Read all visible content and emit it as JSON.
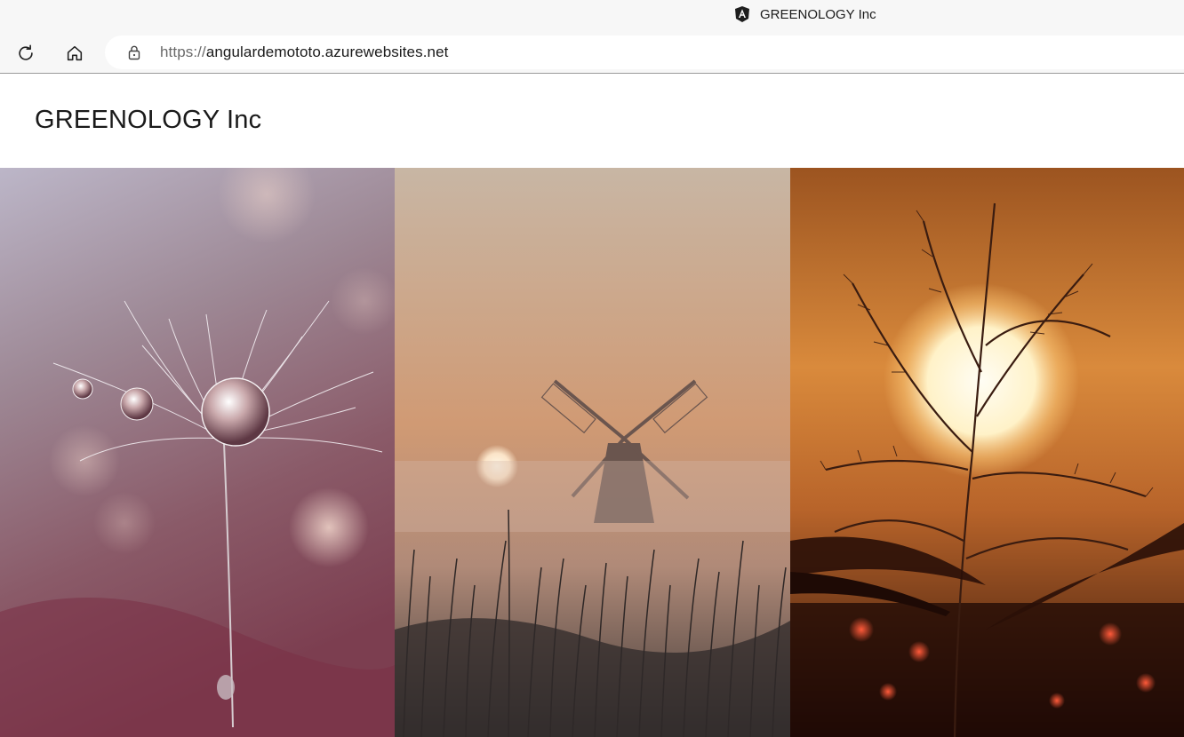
{
  "browser": {
    "tab": {
      "title": "GREENOLOGY Inc",
      "favicon": "angular-logo-icon"
    },
    "address_bar": {
      "scheme": "https://",
      "host": "angulardemototo.azurewebsites.net"
    },
    "icons": {
      "reload": "reload-icon",
      "home": "home-icon",
      "lock": "lock-icon"
    }
  },
  "page": {
    "brand_title": "GREENOLOGY Inc",
    "gallery": [
      {
        "subject": "dandelion-seed-with-water-droplets"
      },
      {
        "subject": "windmill-in-fog-at-sunrise"
      },
      {
        "subject": "reed-silhouette-against-sun"
      }
    ]
  }
}
